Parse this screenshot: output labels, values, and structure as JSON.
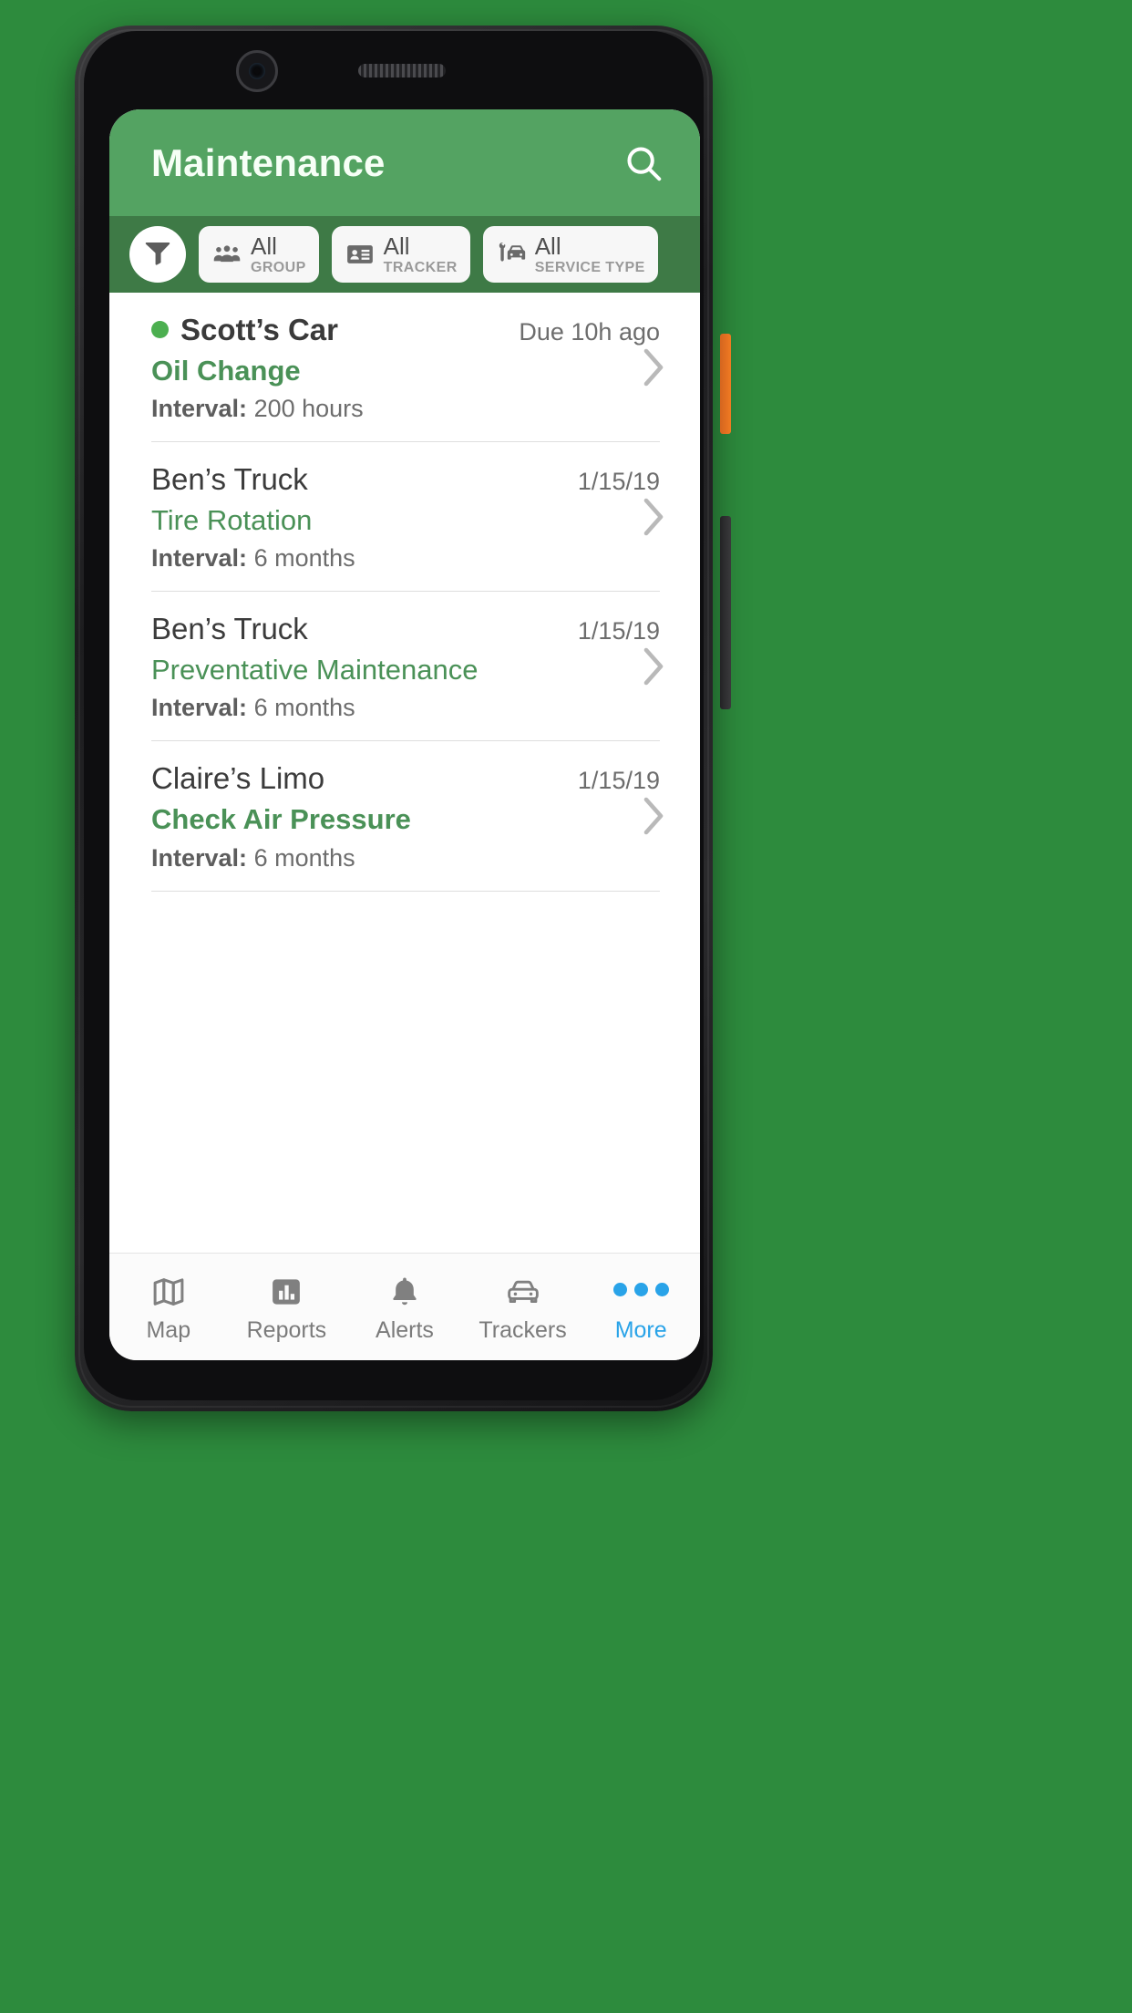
{
  "app": {
    "title": "Maintenance",
    "search_icon": "search-icon",
    "accent_green": "#54a362",
    "filterbar_green": "#3e7a46",
    "service_green": "#4a9157",
    "active_blue": "#29a3e8"
  },
  "filters": {
    "filter_icon": "funnel-icon",
    "chips": [
      {
        "value": "All",
        "label": "GROUP",
        "icon": "group-people-icon"
      },
      {
        "value": "All",
        "label": "TRACKER",
        "icon": "id-card-icon"
      },
      {
        "value": "All",
        "label": "SERVICE TYPE",
        "icon": "car-wrench-icon"
      }
    ]
  },
  "list": {
    "rows": [
      {
        "tracker": "Scott’s Car",
        "status_dot": true,
        "due": "Due 10h ago",
        "service": "Oil Change",
        "interval_label": "Interval:",
        "interval_value": "200 hours",
        "emphasis": true,
        "chevron": "chevron-right-icon"
      },
      {
        "tracker": "Ben’s Truck",
        "status_dot": false,
        "due": "1/15/19",
        "service": "Tire Rotation",
        "interval_label": "Interval:",
        "interval_value": "6 months",
        "emphasis": false,
        "chevron": "chevron-right-icon"
      },
      {
        "tracker": "Ben’s Truck",
        "status_dot": false,
        "due": "1/15/19",
        "service": "Preventative Maintenance",
        "interval_label": "Interval:",
        "interval_value": "6 months",
        "emphasis": false,
        "chevron": "chevron-right-icon"
      },
      {
        "tracker": "Claire’s Limo",
        "status_dot": false,
        "due": "1/15/19",
        "service": "Check Air Pressure",
        "interval_label": "Interval:",
        "interval_value": "6 months",
        "emphasis": false,
        "chevron": "chevron-right-icon"
      }
    ]
  },
  "tabbar": {
    "items": [
      {
        "label": "Map",
        "icon": "map-icon",
        "active": false
      },
      {
        "label": "Reports",
        "icon": "bar-chart-icon",
        "active": false
      },
      {
        "label": "Alerts",
        "icon": "bell-icon",
        "active": false
      },
      {
        "label": "Trackers",
        "icon": "car-icon",
        "active": false
      },
      {
        "label": "More",
        "icon": "ellipsis-icon",
        "active": true
      }
    ]
  }
}
